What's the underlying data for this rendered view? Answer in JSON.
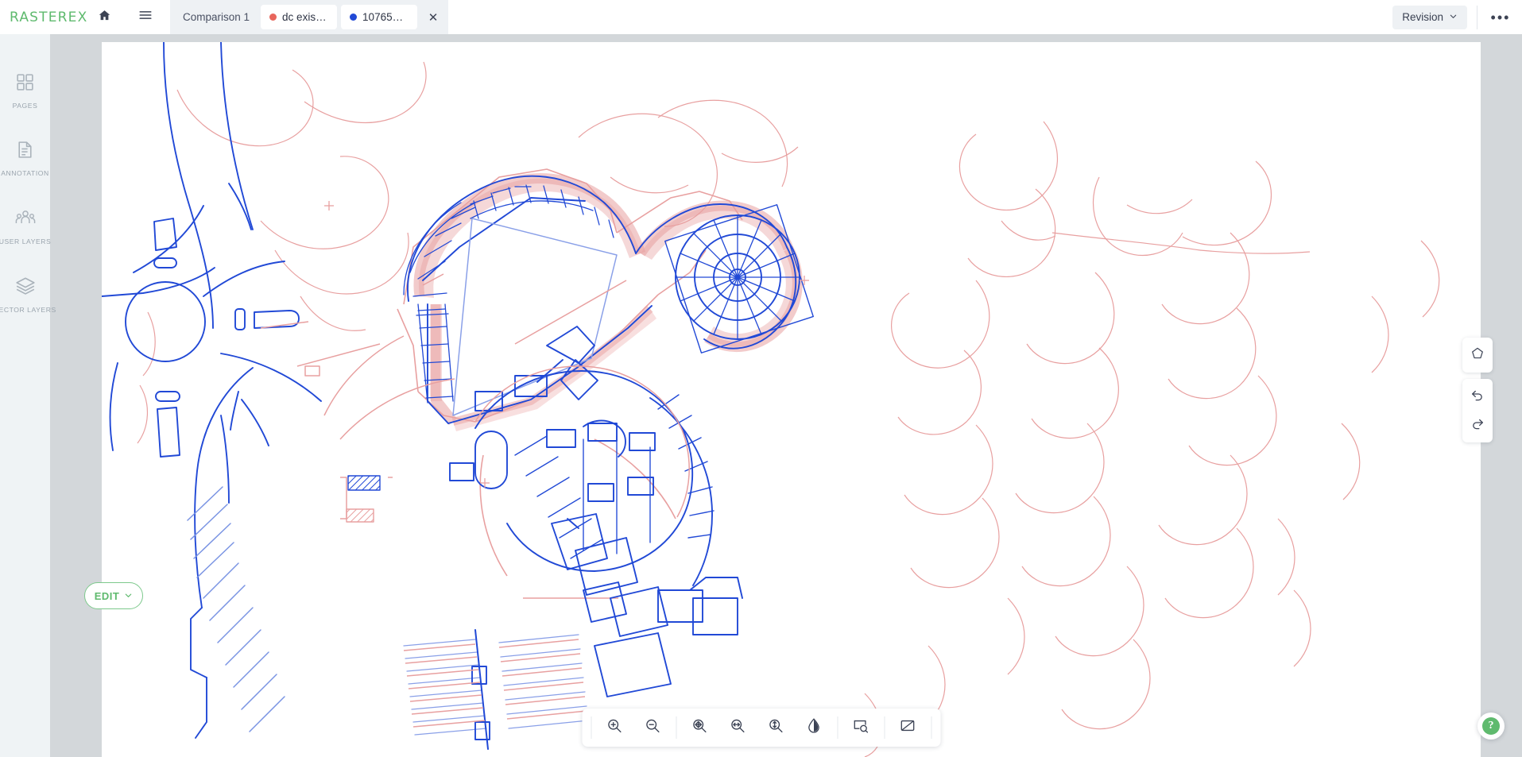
{
  "app": {
    "brand": "RASTEREX"
  },
  "header": {
    "home_icon": "home-icon",
    "menu_icon": "hamburger-menu-icon",
    "comparison_label": "Comparison 1",
    "tabs": [
      {
        "label": "dc existing.p...",
        "dot_color": "#e8665c",
        "icon": "dot-icon"
      },
      {
        "label": "1076536EX-...",
        "dot_color": "#2149d6",
        "icon": "dot-icon"
      }
    ],
    "close_label": "✕",
    "revision": {
      "label": "Revision",
      "chevron": "chevron-down-icon"
    },
    "kebab_label": "•••"
  },
  "sidebar": {
    "items": [
      {
        "label": "PAGES",
        "icon": "pages-grid-icon"
      },
      {
        "label": "ANNOTATION",
        "icon": "annotation-document-icon"
      },
      {
        "label": "USER LAYERS",
        "icon": "users-group-icon"
      },
      {
        "label": "VECTOR LAYERS",
        "icon": "layers-stack-icon"
      }
    ]
  },
  "edit": {
    "label": "EDIT",
    "chevron": "chevron-down-icon"
  },
  "toolbar": {
    "buttons": [
      {
        "name": "zoom-in-button",
        "icon": "magnifier-plus-icon",
        "title": "Zoom In"
      },
      {
        "name": "zoom-out-button",
        "icon": "magnifier-minus-icon",
        "title": "Zoom Out"
      },
      {
        "name": "zoom-window-button",
        "icon": "magnifier-move-plus-icon",
        "title": "Zoom Window"
      },
      {
        "name": "zoom-previous-button",
        "icon": "magnifier-move-minus-icon",
        "title": "Zoom Previous"
      },
      {
        "name": "zoom-fit-height-button",
        "icon": "magnifier-fit-height-icon",
        "title": "Fit Height"
      },
      {
        "name": "contrast-button",
        "icon": "contrast-droplet-icon",
        "title": "Contrast"
      },
      {
        "name": "pan-magnify-button",
        "icon": "screen-magnifier-icon",
        "title": "Magnifier"
      },
      {
        "name": "toggle-overlay-button",
        "icon": "image-off-icon",
        "title": "Toggle Overlay"
      }
    ]
  },
  "right_panel": {
    "shape_tool": {
      "name": "polygon-shape-button",
      "icon": "pentagon-icon"
    },
    "undo": {
      "name": "undo-button",
      "icon": "undo-arrow-icon"
    },
    "redo": {
      "name": "redo-button",
      "icon": "redo-arrow-icon"
    }
  },
  "help": {
    "label": "?"
  },
  "canvas": {
    "title": "CAD revision comparison overlay",
    "legend": {
      "new_color": "#2149d6",
      "existing_color": "#e8a0a0"
    }
  }
}
